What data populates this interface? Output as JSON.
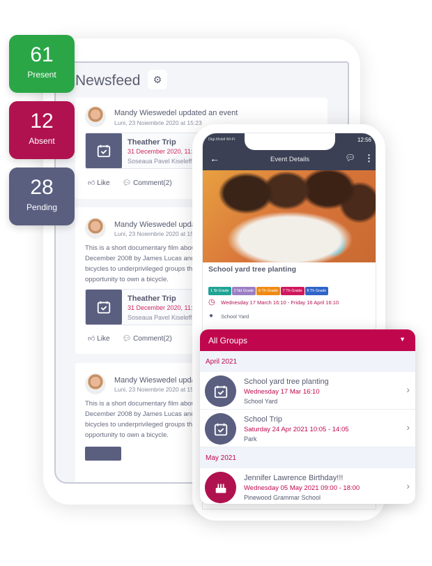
{
  "stats": [
    {
      "value": "61",
      "label": "Present",
      "color": "#2aa647"
    },
    {
      "value": "12",
      "label": "Absent",
      "color": "#b0124f"
    },
    {
      "value": "28",
      "label": "Pending",
      "color": "#5a5f80"
    }
  ],
  "newsfeed": {
    "title": "Newsfeed",
    "posts": [
      {
        "author": "Mandy Wieswedel updated an event",
        "date": "Luni, 23 Noiembrie 2020 at 15:23",
        "event": {
          "title": "Theather Trip",
          "date": "31 December 2020, 11:40",
          "location": "Soseaua Pavel Kiseleff"
        },
        "like": "Like",
        "comment": "Comment(2)"
      },
      {
        "author": "Mandy Wieswedel updated an event",
        "date": "Luni, 23 Noiembrie 2020 at 15:23",
        "body": [
          "This is a short documentary film about",
          "December 2008 by James Lucas and",
          "bicycles to underprivileged groups that",
          "opportunity to own a bicycle."
        ],
        "event": {
          "title": "Theather Trip",
          "date": "31 December 2020, 11:40",
          "location": "Soseaua Pavel Kiseleff"
        },
        "like": "Like",
        "comment": "Comment(2)"
      },
      {
        "author": "Mandy Wieswedel updated an event",
        "date": "Luni, 23 Noiembrie 2020 at 15:23",
        "body": [
          "This is a short documentary film about",
          "December 2008 by James Lucas and",
          "bicycles to underprivileged groups that",
          "opportunity to own a bicycle."
        ]
      }
    ]
  },
  "phone": {
    "carrier": "Digi.Mobil Wi-Fi",
    "time": "12:56",
    "header": "Event Details",
    "event_title": "School yard tree planting",
    "tags": [
      {
        "label": "1 St Grade",
        "color": "#1fa394"
      },
      {
        "label": "2 Nd Grade",
        "color": "#9b7fc4"
      },
      {
        "label": "6 Th Grade",
        "color": "#f08a14"
      },
      {
        "label": "7 Th Grade",
        "color": "#d0185e"
      },
      {
        "label": "8 Th Grade",
        "color": "#2f64c8"
      }
    ],
    "datetime": "Wednesday 17 March 16:10 - Friday 16 April 16:10",
    "location": "School Yard"
  },
  "calendar": {
    "filter": "All Groups",
    "months": [
      {
        "label": "April 2021",
        "events": [
          {
            "title": "School yard tree planting",
            "date": "Wednesday 17 Mar 16:10",
            "location": "School Yard",
            "icon": "calendar-check"
          },
          {
            "title": "School Trip",
            "date": "Saturday 24 Apr 2021 10:05 - 14:05",
            "location": "Park",
            "icon": "calendar-check"
          }
        ]
      },
      {
        "label": "May 2021",
        "events": [
          {
            "title": "Jennifer Lawrence Birthday!!!",
            "date": "Wednesday 05 May 2021 09:00 - 18:00",
            "location": "Pinewood Grammar School",
            "icon": "birthday-cake"
          }
        ]
      }
    ]
  },
  "colors": {
    "accent": "#c0074d",
    "slate": "#5a5f80",
    "dark_header": "#3c4054"
  }
}
